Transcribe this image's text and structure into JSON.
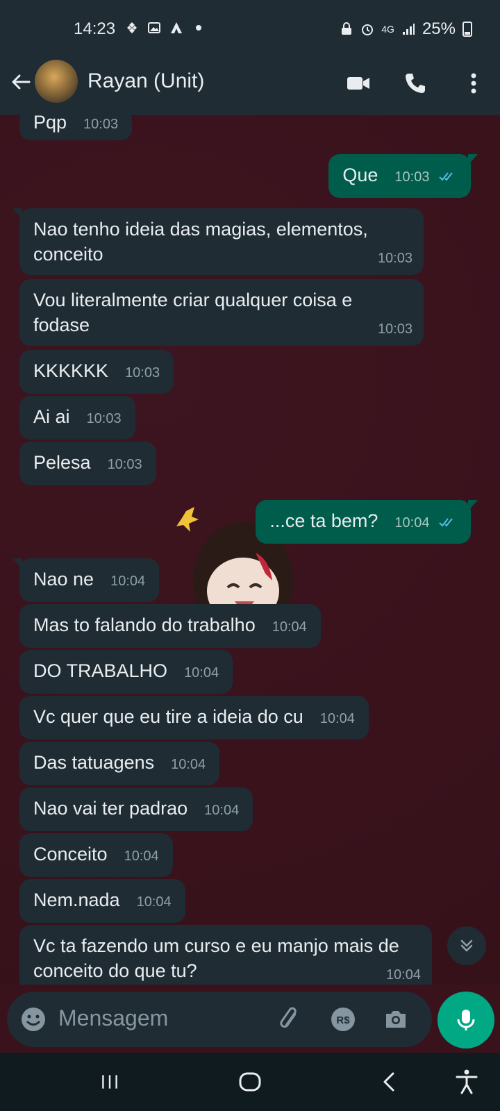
{
  "status_bar": {
    "time": "14:23",
    "battery": "25%",
    "network": "4G"
  },
  "header": {
    "contact_name": "Rayan (Unit)",
    "icons": [
      "back-arrow-icon",
      "video-call-icon",
      "voice-call-icon",
      "more-options-icon"
    ]
  },
  "messages": [
    {
      "dir": "in",
      "text": "Pqp",
      "time": "10:03"
    },
    {
      "dir": "out",
      "text": "Que",
      "time": "10:03",
      "read": true
    },
    {
      "dir": "in",
      "text": "Nao tenho ideia das magias, elementos, conceito",
      "time": "10:03"
    },
    {
      "dir": "in",
      "text": "Vou literalmente criar qualquer coisa e fodase",
      "time": "10:03"
    },
    {
      "dir": "in",
      "text": "KKKKKK",
      "time": "10:03"
    },
    {
      "dir": "in",
      "text": "Ai ai",
      "time": "10:03"
    },
    {
      "dir": "in",
      "text": "Pelesa",
      "time": "10:03"
    },
    {
      "dir": "out",
      "text": "...ce ta bem?",
      "time": "10:04",
      "read": true
    },
    {
      "dir": "in",
      "text": "Nao ne",
      "time": "10:04"
    },
    {
      "dir": "in",
      "text": "Mas to falando do trabalho",
      "time": "10:04"
    },
    {
      "dir": "in",
      "text": "DO TRABALHO",
      "time": "10:04"
    },
    {
      "dir": "in",
      "text": "Vc quer que eu tire a ideia do cu",
      "time": "10:04"
    },
    {
      "dir": "in",
      "text": "Das tatuagens",
      "time": "10:04"
    },
    {
      "dir": "in",
      "text": "Nao vai ter padrao",
      "time": "10:04"
    },
    {
      "dir": "in",
      "text": "Conceito",
      "time": "10:04"
    },
    {
      "dir": "in",
      "text": "Nem.nada",
      "time": "10:04"
    },
    {
      "dir": "in",
      "text": "Vc ta fazendo um curso e eu manjo mais de conceito do que tu?",
      "time": "10:04"
    }
  ],
  "input": {
    "placeholder": "Mensagem"
  },
  "colors": {
    "chat_bg": "#3a121c",
    "incoming_bubble": "#1f2c34",
    "outgoing_bubble": "#005c4b",
    "accent": "#00a884",
    "read_ticks": "#53bdeb"
  }
}
